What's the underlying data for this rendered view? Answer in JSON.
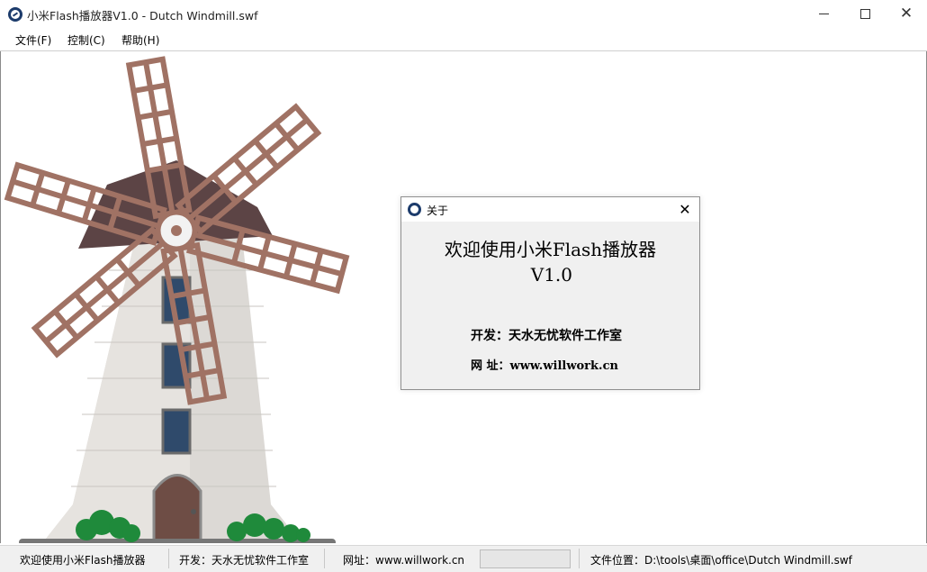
{
  "window": {
    "title": "小米Flash播放器V1.0 - Dutch Windmill.swf",
    "icon": "flash-player-icon",
    "minimize_icon": "minimize-icon",
    "maximize_icon": "maximize-icon",
    "close_glyph": "✕"
  },
  "menu": {
    "file": "文件(F)",
    "control": "控制(C)",
    "help": "帮助(H)"
  },
  "dialog": {
    "title": "关于",
    "close_glyph": "✕",
    "heading": "欢迎使用小米Flash播放器",
    "version": "V1.0",
    "developer": "开发：天水无忧软件工作室",
    "website": "网 址：www.willwork.cn"
  },
  "status": {
    "welcome": "欢迎使用小米Flash播放器",
    "developer": "开发：天水无忧软件工作室",
    "website": "网址：www.willwork.cn",
    "file_location": "文件位置：D:\\tools\\桌面\\office\\Dutch Windmill.swf"
  },
  "colors": {
    "accent": "#1c3b6b",
    "windmill_roof": "#5c4445",
    "windmill_blades": "#a07264",
    "windmill_wall": "#d8d5d1",
    "bush": "#1f8a3b"
  }
}
